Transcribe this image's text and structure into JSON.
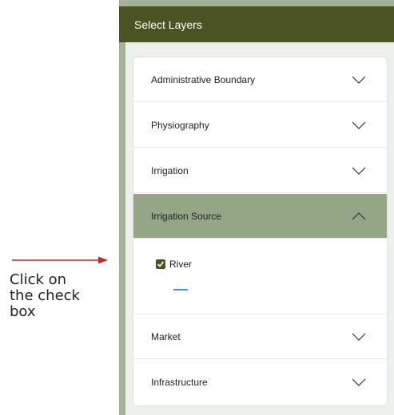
{
  "header": {
    "title": "Select Layers"
  },
  "layers": [
    {
      "label": "Administrative Boundary",
      "expanded": false
    },
    {
      "label": "Physiography",
      "expanded": false
    },
    {
      "label": "Irrigation",
      "expanded": false
    },
    {
      "label": "Irrigation Source",
      "expanded": true
    },
    {
      "label": "Market",
      "expanded": false
    },
    {
      "label": "Infrastructure",
      "expanded": false
    }
  ],
  "irrigation_source": {
    "checkbox_label": "River",
    "checked": true
  },
  "annotation": {
    "text": "Click on\nthe check\nbox"
  },
  "colors": {
    "header_bg": "#4b5322",
    "active_row_bg": "#94a685",
    "panel_bg": "#a4b299",
    "arrow": "#c62828",
    "legend_line": "#4a90d9"
  }
}
